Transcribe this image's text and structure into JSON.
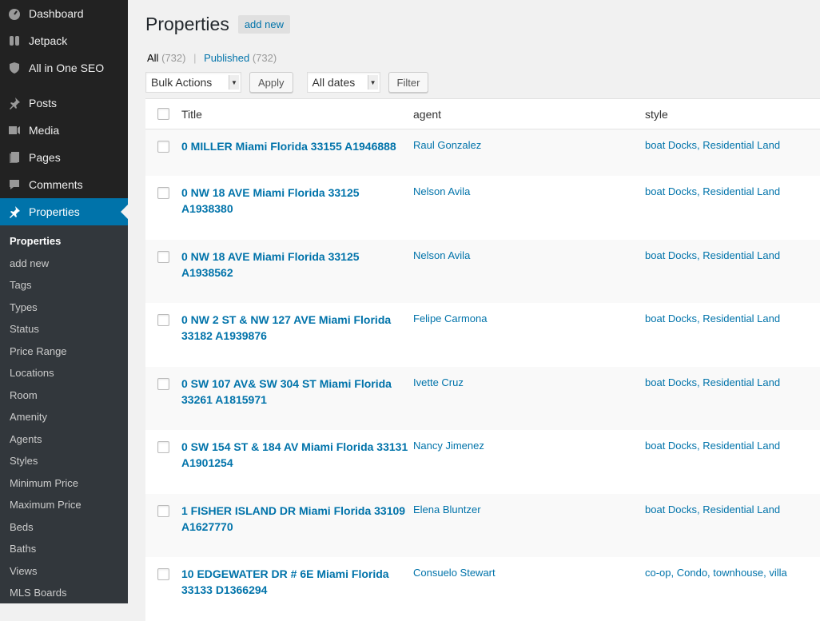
{
  "sidebar": {
    "top_items": [
      {
        "label": "Dashboard",
        "icon": "dashboard-icon"
      },
      {
        "label": "Jetpack",
        "icon": "jetpack-icon"
      },
      {
        "label": "All in One SEO",
        "icon": "shield-icon"
      }
    ],
    "items": [
      {
        "label": "Posts",
        "icon": "pin-icon"
      },
      {
        "label": "Media",
        "icon": "media-icon"
      },
      {
        "label": "Pages",
        "icon": "pages-icon"
      },
      {
        "label": "Comments",
        "icon": "comment-icon"
      }
    ],
    "current": {
      "label": "Properties",
      "icon": "pin-icon"
    },
    "submenu": [
      "Properties",
      "add new",
      "Tags",
      "Types",
      "Status",
      "Price Range",
      "Locations",
      "Room",
      "Amenity",
      "Agents",
      "Styles",
      "Minimum Price",
      "Maximum Price",
      "Beds",
      "Baths",
      "Views",
      "MLS Boards"
    ]
  },
  "header": {
    "title": "Properties",
    "add_new": "add new"
  },
  "filters": {
    "all_label": "All",
    "all_count": "(732)",
    "published_label": "Published",
    "published_count": "(732)",
    "separator": "|"
  },
  "tablenav": {
    "bulk_actions": "Bulk Actions",
    "apply": "Apply",
    "dates": "All dates",
    "filter": "Filter"
  },
  "table": {
    "columns": [
      "Title",
      "agent",
      "style"
    ],
    "rows": [
      {
        "title": "0 MILLER Miami Florida 33155 A1946888",
        "agent": "Raul Gonzalez",
        "style": "boat Docks, Residential Land"
      },
      {
        "title": "0 NW 18 AVE Miami Florida 33125 A1938380",
        "agent": "Nelson Avila",
        "style": "boat Docks, Residential Land"
      },
      {
        "title": "0 NW 18 AVE Miami Florida 33125 A1938562",
        "agent": "Nelson Avila",
        "style": "boat Docks, Residential Land"
      },
      {
        "title": "0 NW 2 ST & NW 127 AVE Miami Florida 33182 A1939876",
        "agent": "Felipe Carmona",
        "style": "boat Docks, Residential Land"
      },
      {
        "title": "0 SW 107 AV& SW 304 ST Miami Florida 33261 A1815971",
        "agent": "Ivette Cruz",
        "style": "boat Docks, Residential Land"
      },
      {
        "title": "0 SW 154 ST & 184 AV Miami Florida 33131 A1901254",
        "agent": "Nancy Jimenez",
        "style": "boat Docks, Residential Land"
      },
      {
        "title": "1 FISHER ISLAND DR Miami Florida 33109 A1627770",
        "agent": "Elena Bluntzer",
        "style": "boat Docks, Residential Land"
      },
      {
        "title": "10 EDGEWATER DR # 6E Miami Florida 33133 D1366294",
        "agent": "Consuelo Stewart",
        "style": "co-op, Condo, townhouse, villa"
      }
    ]
  }
}
